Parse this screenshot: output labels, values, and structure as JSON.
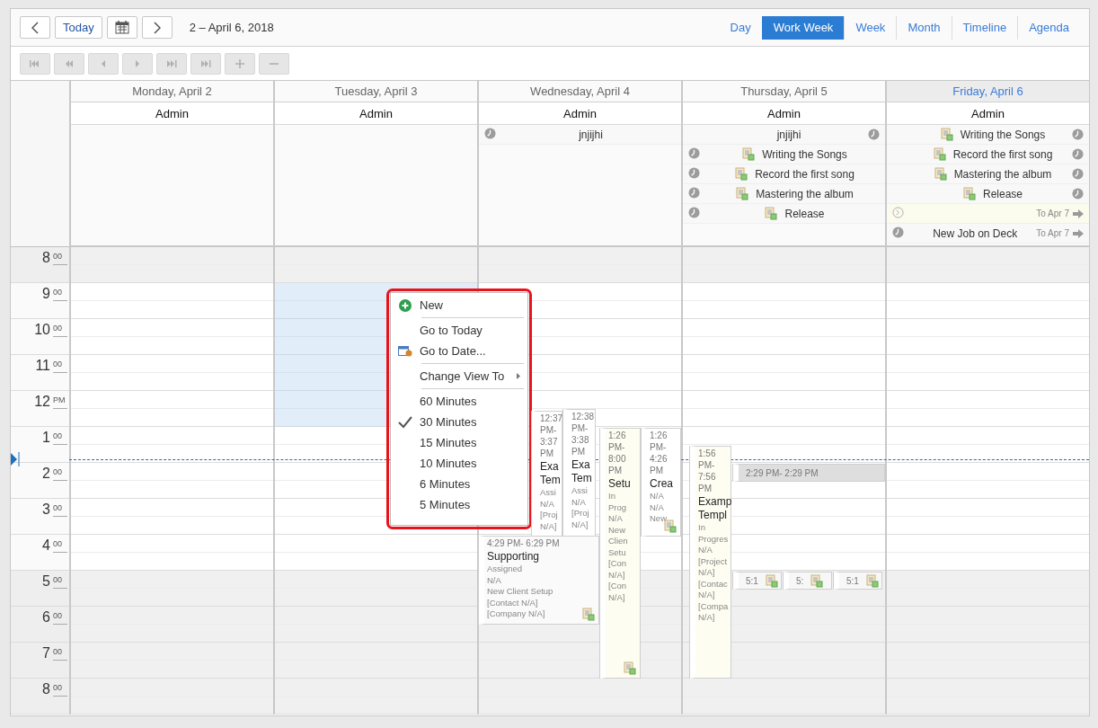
{
  "toolbar": {
    "today_button": "Today",
    "date_range": "2 – April 6, 2018",
    "views": [
      {
        "label": "Day",
        "selected": false
      },
      {
        "label": "Work Week",
        "selected": true
      },
      {
        "label": "Week",
        "selected": false
      },
      {
        "label": "Month",
        "selected": false
      },
      {
        "label": "Timeline",
        "selected": false
      },
      {
        "label": "Agenda",
        "selected": false
      }
    ]
  },
  "nav_buttons": [
    {
      "kind": "first",
      "disabled": true
    },
    {
      "kind": "prev-page",
      "disabled": true
    },
    {
      "kind": "prev",
      "disabled": true
    },
    {
      "kind": "next",
      "disabled": true
    },
    {
      "kind": "next-page",
      "disabled": true
    },
    {
      "kind": "last",
      "disabled": true
    },
    {
      "kind": "add",
      "disabled": true
    },
    {
      "kind": "remove",
      "disabled": true
    }
  ],
  "time_slots": [
    {
      "hour": "8",
      "suffix": "00",
      "work": false
    },
    {
      "hour": "9",
      "suffix": "00",
      "work": true
    },
    {
      "hour": "10",
      "suffix": "00",
      "work": true
    },
    {
      "hour": "11",
      "suffix": "00",
      "work": true
    },
    {
      "hour": "12",
      "suffix": "PM",
      "work": true
    },
    {
      "hour": "1",
      "suffix": "00",
      "work": true
    },
    {
      "hour": "2",
      "suffix": "00",
      "work": true
    },
    {
      "hour": "3",
      "suffix": "00",
      "work": true
    },
    {
      "hour": "4",
      "suffix": "00",
      "work": true
    },
    {
      "hour": "5",
      "suffix": "00",
      "work": false
    },
    {
      "hour": "6",
      "suffix": "00",
      "work": false
    },
    {
      "hour": "7",
      "suffix": "00",
      "work": false
    },
    {
      "hour": "8",
      "suffix": "00",
      "work": false
    }
  ],
  "days": [
    {
      "name": "Monday, April 2",
      "resource": "Admin",
      "today": false,
      "selected": false
    },
    {
      "name": "Tuesday, April 3",
      "resource": "Admin",
      "today": false,
      "selected": true
    },
    {
      "name": "Wednesday, April 4",
      "resource": "Admin",
      "today": false,
      "selected": false,
      "all_day": [
        {
          "kind": "task",
          "title": "jnjijhi",
          "clock_trailing": false,
          "doc": false
        }
      ],
      "appointments": [
        {
          "time": "12:37 PM- 3:37 PM",
          "title": "Exa Tem",
          "details": [
            "Assi",
            "N/A",
            "[Proj",
            "N/A]"
          ],
          "color": "#ffffff",
          "doc": false
        },
        {
          "time": "12:38 PM- 3:38 PM",
          "title": "Exa Tem",
          "details": [
            "Assi",
            "N/A",
            "[Proj",
            "N/A]"
          ],
          "color": "#ffffff",
          "doc": false
        },
        {
          "time": "1:26 PM- 8:00 PM",
          "title": "Setu",
          "details": [
            "In",
            "Prog",
            "N/A",
            "New",
            "Clien",
            "Setu",
            "[Con",
            "N/A]",
            "[Con",
            "N/A]"
          ],
          "color": "#fdfdf2",
          "doc": true
        },
        {
          "time": "1:26 PM- 4:26 PM",
          "title": "Crea",
          "details": [
            "N/A",
            "N/A",
            "New"
          ],
          "color": "#ffffff",
          "doc": true
        },
        {
          "time": "4:29 PM- 6:29 PM",
          "title": "Supporting",
          "details": [
            "Assigned",
            "N/A",
            "New Client Setup",
            "[Contact N/A]",
            "[Company N/A]"
          ],
          "color": "#fafafa",
          "doc": true
        }
      ]
    },
    {
      "name": "Thursday, April 5",
      "resource": "Admin",
      "today": false,
      "selected": false,
      "all_day": [
        {
          "kind": "task",
          "title": "jnjijhi",
          "clock_trailing": true,
          "doc": false
        },
        {
          "kind": "task",
          "title": "Writing the Songs",
          "clock_trailing": false,
          "doc": true
        },
        {
          "kind": "task",
          "title": "Record the first song",
          "clock_trailing": false,
          "doc": true
        },
        {
          "kind": "task",
          "title": "Mastering the album",
          "clock_trailing": false,
          "doc": true
        },
        {
          "kind": "task",
          "title": "Release",
          "clock_trailing": false,
          "doc": true
        }
      ],
      "appointments": [
        {
          "time": "1:56 PM- 7:56 PM",
          "title": "Examp Templ",
          "details": [
            "In",
            "Progres",
            "N/A",
            "[Project",
            "N/A]",
            "[Contac",
            "N/A]",
            "[Compa",
            "N/A]"
          ],
          "color": "#fdfdf2",
          "doc": false
        },
        {
          "time": "2:29 PM- 2:29 PM",
          "color": "#dedede",
          "doc": false
        },
        {
          "time": "5:1",
          "color": "#f7f7f7",
          "doc": true
        },
        {
          "time": "5:",
          "color": "#f7f7f7",
          "doc": true
        },
        {
          "time": "5:1",
          "color": "#f7f7f7",
          "doc": true
        }
      ]
    },
    {
      "name": "Friday, April 6",
      "resource": "Admin",
      "today": true,
      "selected": false,
      "all_day": [
        {
          "kind": "task",
          "title": "Writing the Songs",
          "clock_trailing": true,
          "doc": true
        },
        {
          "kind": "task",
          "title": "Record the first song",
          "clock_trailing": true,
          "doc": true
        },
        {
          "kind": "task",
          "title": "Mastering the album",
          "clock_trailing": true,
          "doc": true
        },
        {
          "kind": "task",
          "title": "Release",
          "clock_trailing": true,
          "doc": true
        },
        {
          "kind": "draft",
          "clock_trailing": false,
          "doc": false,
          "continues": "To Apr 7"
        },
        {
          "kind": "task",
          "title": "New Job on Deck",
          "clock_trailing": false,
          "doc": false,
          "continues": "To Apr 7"
        }
      ]
    }
  ],
  "context_menu": {
    "items": [
      {
        "kind": "command",
        "label": "New"
      },
      {
        "kind": "separator"
      },
      {
        "kind": "command",
        "label": "Go to Today"
      },
      {
        "kind": "command",
        "label": "Go to Date..."
      },
      {
        "kind": "separator"
      },
      {
        "kind": "submenu",
        "label": "Change View To"
      },
      {
        "kind": "separator"
      },
      {
        "kind": "option",
        "label": "60 Minutes",
        "checked": false
      },
      {
        "kind": "option",
        "label": "30 Minutes",
        "checked": true
      },
      {
        "kind": "option",
        "label": "15 Minutes",
        "checked": false
      },
      {
        "kind": "option",
        "label": "10 Minutes",
        "checked": false
      },
      {
        "kind": "option",
        "label": "6 Minutes",
        "checked": false
      },
      {
        "kind": "option",
        "label": "5 Minutes",
        "checked": false
      }
    ]
  }
}
